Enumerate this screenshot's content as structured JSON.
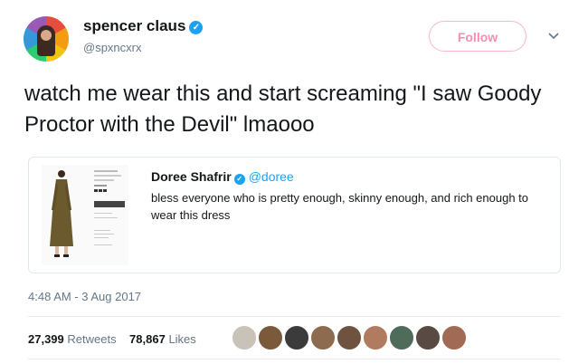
{
  "author": {
    "name": "spencer claus",
    "handle": "@spxncxrx",
    "verified_glyph": "✓"
  },
  "follow_label": "Follow",
  "tweet_text": "watch me wear this and start screaming \"I saw Goody Proctor with the Devil\" lmaooo",
  "quoted": {
    "author_name": "Doree Shafrir",
    "author_handle": "@doree",
    "verified_glyph": "✓",
    "text": "bless everyone who is pretty enough, skinny enough, and rich enough to wear this dress"
  },
  "timestamp": "4:48 AM - 3 Aug 2017",
  "stats": {
    "retweets_count": "27,399",
    "retweets_label": "Retweets",
    "likes_count": "78,867",
    "likes_label": "Likes"
  },
  "liker_colors": [
    "#c9c2b8",
    "#7a5a3a",
    "#3b3b3b",
    "#8c6b4f",
    "#6f5240",
    "#b07b5e",
    "#4f6b5a",
    "#5a4a44",
    "#a06a54"
  ],
  "colors": {
    "accent": "#1da1f2",
    "follow_border": "#f6b6d0",
    "follow_text": "#f48fb1"
  },
  "icons": {
    "caret": "chevron-down-icon",
    "verified": "verified-badge-icon"
  }
}
